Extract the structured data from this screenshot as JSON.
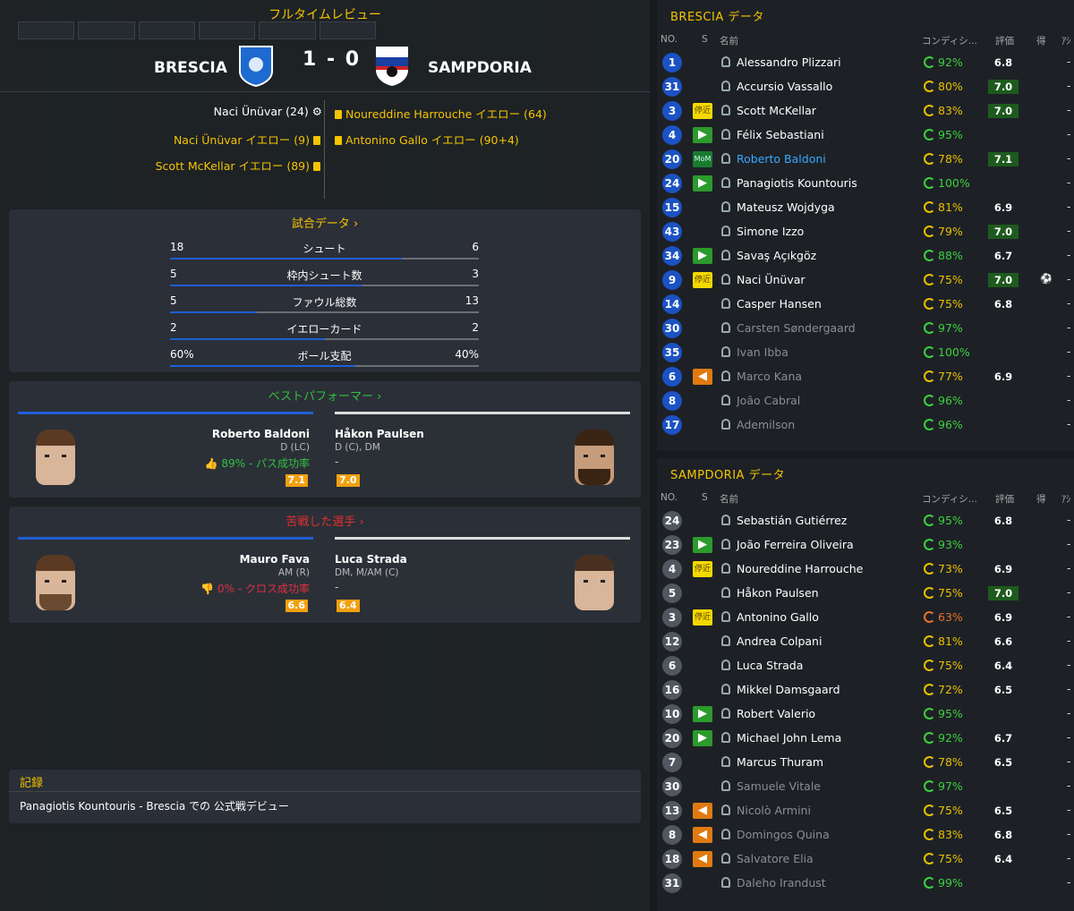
{
  "header": {
    "title": "フルタイムレビュー",
    "home": "BRESCIA",
    "away": "SAMPDORIA",
    "score": "1 - 0"
  },
  "events": {
    "home": [
      {
        "text": "Naci Ünüvar (24)",
        "type": "goal"
      },
      {
        "text": "Naci Ünüvar イエロー (9)",
        "type": "yellow"
      },
      {
        "text": "Scott McKellar イエロー (89)",
        "type": "yellow"
      }
    ],
    "away": [
      {
        "text": "Noureddine Harrouche イエロー (64)",
        "type": "yellow"
      },
      {
        "text": "Antonino Gallo イエロー (90+4)",
        "type": "yellow"
      }
    ]
  },
  "match_stats": {
    "title": "試合データ ›",
    "rows": [
      {
        "label": "シュート",
        "home": "18",
        "away": "6",
        "home_share": 0.75
      },
      {
        "label": "枠内シュート数",
        "home": "5",
        "away": "3",
        "home_share": 0.62
      },
      {
        "label": "ファウル総数",
        "home": "5",
        "away": "13",
        "home_share": 0.28
      },
      {
        "label": "イエローカード",
        "home": "2",
        "away": "2",
        "home_share": 0.5
      },
      {
        "label": "ボール支配",
        "home": "60%",
        "away": "40%",
        "home_share": 0.6
      }
    ]
  },
  "best": {
    "title": "ベストパフォーマー ›",
    "home": {
      "name": "Roberto Baldoni",
      "pos": "D (LC)",
      "stat": "89% - パス成功率",
      "rating": "7.1"
    },
    "away": {
      "name": "Håkon Paulsen",
      "pos": "D (C), DM",
      "stat": "-",
      "rating": "7.0"
    }
  },
  "worst": {
    "title": "苦戦した選手 ›",
    "home": {
      "name": "Mauro Fava",
      "pos": "AM (R)",
      "stat": "0% - クロス成功率",
      "rating": "6.6"
    },
    "away": {
      "name": "Luca Strada",
      "pos": "DM, M/AM (C)",
      "stat": "-",
      "rating": "6.4"
    }
  },
  "notes": {
    "title": "記録",
    "text": "Panagiotis Kountouris - Brescia での 公式戦デビュー"
  },
  "columns": {
    "no": "NO.",
    "s": "S",
    "name": "名前",
    "cond": "コンディシ...",
    "rating": "評価",
    "goals": "得",
    "assists": "ｱｼ"
  },
  "brescia": {
    "title": "BRESCIA データ",
    "players": [
      {
        "no": "1",
        "badge": "",
        "name": "Alessandro Plizzari",
        "cond": "92%",
        "cc": "#3ecf3e",
        "rating": "6.8",
        "hi": false,
        "x": "-",
        "misc": ""
      },
      {
        "no": "31",
        "badge": "",
        "name": "Accursio Vassallo",
        "cond": "80%",
        "cc": "#e8c000",
        "rating": "7.0",
        "hi": true,
        "x": "-",
        "misc": ""
      },
      {
        "no": "3",
        "badge": "sus",
        "badge_text": "停近",
        "name": "Scott McKellar",
        "cond": "83%",
        "cc": "#e8c000",
        "rating": "7.0",
        "hi": true,
        "x": "-",
        "misc": ""
      },
      {
        "no": "4",
        "badge": "in",
        "badge_text": "▶",
        "name": "Félix Sebastiani",
        "cond": "95%",
        "cc": "#3ecf3e",
        "rating": "",
        "hi": false,
        "x": "-",
        "misc": ""
      },
      {
        "no": "20",
        "badge": "mom",
        "badge_text": "MoM",
        "name": "Roberto Baldoni",
        "cond": "78%",
        "cc": "#e8c000",
        "rating": "7.1",
        "hi": true,
        "x": "-",
        "misc": "",
        "name_hl": true
      },
      {
        "no": "24",
        "badge": "in",
        "badge_text": "▶",
        "name": "Panagiotis Kountouris",
        "cond": "100%",
        "cc": "#3ecf3e",
        "rating": "",
        "hi": false,
        "x": "-",
        "misc": ""
      },
      {
        "no": "15",
        "badge": "",
        "name": "Mateusz Wojdyga",
        "cond": "81%",
        "cc": "#e8c000",
        "rating": "6.9",
        "hi": false,
        "x": "-",
        "misc": ""
      },
      {
        "no": "43",
        "badge": "",
        "name": "Simone Izzo",
        "cond": "79%",
        "cc": "#e8c000",
        "rating": "7.0",
        "hi": true,
        "x": "-",
        "misc": ""
      },
      {
        "no": "34",
        "badge": "in",
        "badge_text": "▶",
        "name": "Savaş Açıkgöz",
        "cond": "88%",
        "cc": "#3ecf3e",
        "rating": "6.7",
        "hi": false,
        "x": "-",
        "misc": ""
      },
      {
        "no": "9",
        "badge": "sus",
        "badge_text": "停近",
        "name": "Naci Ünüvar",
        "cond": "75%",
        "cc": "#e8c000",
        "rating": "7.0",
        "hi": true,
        "x": "-",
        "misc": "⚽"
      },
      {
        "no": "14",
        "badge": "",
        "name": "Casper Hansen",
        "cond": "75%",
        "cc": "#e8c000",
        "rating": "6.8",
        "hi": false,
        "x": "-",
        "misc": ""
      },
      {
        "no": "30",
        "badge": "",
        "name": "Carsten Søndergaard",
        "cond": "97%",
        "cc": "#3ecf3e",
        "rating": "",
        "hi": false,
        "x": "-",
        "misc": "",
        "dim": true
      },
      {
        "no": "35",
        "badge": "",
        "name": "Ivan Ibba",
        "cond": "100%",
        "cc": "#3ecf3e",
        "rating": "",
        "hi": false,
        "x": "-",
        "misc": "",
        "dim": true
      },
      {
        "no": "6",
        "badge": "out",
        "badge_text": "◀",
        "name": "Marco Kana",
        "cond": "77%",
        "cc": "#e8c000",
        "rating": "6.9",
        "hi": false,
        "x": "-",
        "misc": "",
        "dim": true
      },
      {
        "no": "8",
        "badge": "",
        "name": "João Cabral",
        "cond": "96%",
        "cc": "#3ecf3e",
        "rating": "",
        "hi": false,
        "x": "-",
        "misc": "",
        "dim": true
      },
      {
        "no": "17",
        "badge": "",
        "name": "Ademilson",
        "cond": "96%",
        "cc": "#3ecf3e",
        "rating": "",
        "hi": false,
        "x": "-",
        "misc": "",
        "dim": true
      }
    ]
  },
  "sampdoria": {
    "title": "SAMPDORIA データ",
    "players": [
      {
        "no": "24",
        "badge": "",
        "name": "Sebastián Gutiérrez",
        "cond": "95%",
        "cc": "#3ecf3e",
        "rating": "6.8",
        "hi": false,
        "x": "-",
        "misc": ""
      },
      {
        "no": "23",
        "badge": "in",
        "badge_text": "▶",
        "name": "João Ferreira Oliveira",
        "cond": "93%",
        "cc": "#3ecf3e",
        "rating": "",
        "hi": false,
        "x": "-",
        "misc": ""
      },
      {
        "no": "4",
        "badge": "sus",
        "badge_text": "停近",
        "name": "Noureddine Harrouche",
        "cond": "73%",
        "cc": "#e8c000",
        "rating": "6.9",
        "hi": false,
        "x": "-",
        "misc": ""
      },
      {
        "no": "5",
        "badge": "",
        "name": "Håkon Paulsen",
        "cond": "75%",
        "cc": "#e8c000",
        "rating": "7.0",
        "hi": true,
        "x": "-",
        "misc": ""
      },
      {
        "no": "3",
        "badge": "sus",
        "badge_text": "停近",
        "name": "Antonino Gallo",
        "cond": "63%",
        "cc": "#e8702a",
        "rating": "6.9",
        "hi": false,
        "x": "-",
        "misc": ""
      },
      {
        "no": "12",
        "badge": "",
        "name": "Andrea Colpani",
        "cond": "81%",
        "cc": "#e8c000",
        "rating": "6.6",
        "hi": false,
        "x": "-",
        "misc": ""
      },
      {
        "no": "6",
        "badge": "",
        "name": "Luca Strada",
        "cond": "75%",
        "cc": "#e8c000",
        "rating": "6.4",
        "hi": false,
        "x": "-",
        "misc": ""
      },
      {
        "no": "16",
        "badge": "",
        "name": "Mikkel Damsgaard",
        "cond": "72%",
        "cc": "#e8c000",
        "rating": "6.5",
        "hi": false,
        "x": "-",
        "misc": ""
      },
      {
        "no": "10",
        "badge": "in",
        "badge_text": "▶",
        "name": "Robert Valerio",
        "cond": "95%",
        "cc": "#3ecf3e",
        "rating": "",
        "hi": false,
        "x": "-",
        "misc": ""
      },
      {
        "no": "20",
        "badge": "in",
        "badge_text": "▶",
        "name": "Michael John Lema",
        "cond": "92%",
        "cc": "#3ecf3e",
        "rating": "6.7",
        "hi": false,
        "x": "-",
        "misc": ""
      },
      {
        "no": "7",
        "badge": "",
        "name": "Marcus Thuram",
        "cond": "78%",
        "cc": "#e8c000",
        "rating": "6.5",
        "hi": false,
        "x": "-",
        "misc": ""
      },
      {
        "no": "30",
        "badge": "",
        "name": "Samuele Vitale",
        "cond": "97%",
        "cc": "#3ecf3e",
        "rating": "",
        "hi": false,
        "x": "-",
        "misc": "",
        "dim": true
      },
      {
        "no": "13",
        "badge": "out",
        "badge_text": "◀",
        "name": "Nicolò Armini",
        "cond": "75%",
        "cc": "#e8c000",
        "rating": "6.5",
        "hi": false,
        "x": "-",
        "misc": "",
        "dim": true
      },
      {
        "no": "8",
        "badge": "out",
        "badge_text": "◀",
        "name": "Domingos Quina",
        "cond": "83%",
        "cc": "#e8c000",
        "rating": "6.8",
        "hi": false,
        "x": "-",
        "misc": "",
        "dim": true
      },
      {
        "no": "18",
        "badge": "out",
        "badge_text": "◀",
        "name": "Salvatore Elia",
        "cond": "75%",
        "cc": "#e8c000",
        "rating": "6.4",
        "hi": false,
        "x": "-",
        "misc": "",
        "dim": true
      },
      {
        "no": "31",
        "badge": "",
        "name": "Daleho Irandust",
        "cond": "99%",
        "cc": "#3ecf3e",
        "rating": "",
        "hi": false,
        "x": "-",
        "misc": "",
        "dim": true
      }
    ]
  }
}
